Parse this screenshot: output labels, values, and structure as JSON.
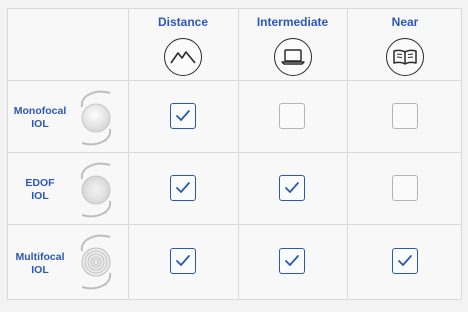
{
  "columns": [
    {
      "title": "Distance",
      "icon": "mountains-icon"
    },
    {
      "title": "Intermediate",
      "icon": "laptop-icon"
    },
    {
      "title": "Near",
      "icon": "book-icon"
    }
  ],
  "rows": [
    {
      "label": "Monofocal\nIOL",
      "lens": "monofocal-lens-icon",
      "checks": [
        true,
        false,
        false
      ]
    },
    {
      "label": "EDOF\nIOL",
      "lens": "edof-lens-icon",
      "checks": [
        true,
        true,
        false
      ]
    },
    {
      "label": "Multifocal\nIOL",
      "lens": "multifocal-lens-icon",
      "checks": [
        true,
        true,
        true
      ]
    }
  ],
  "colors": {
    "accent": "#2b58b8",
    "unchecked": "#b5b5b5"
  }
}
